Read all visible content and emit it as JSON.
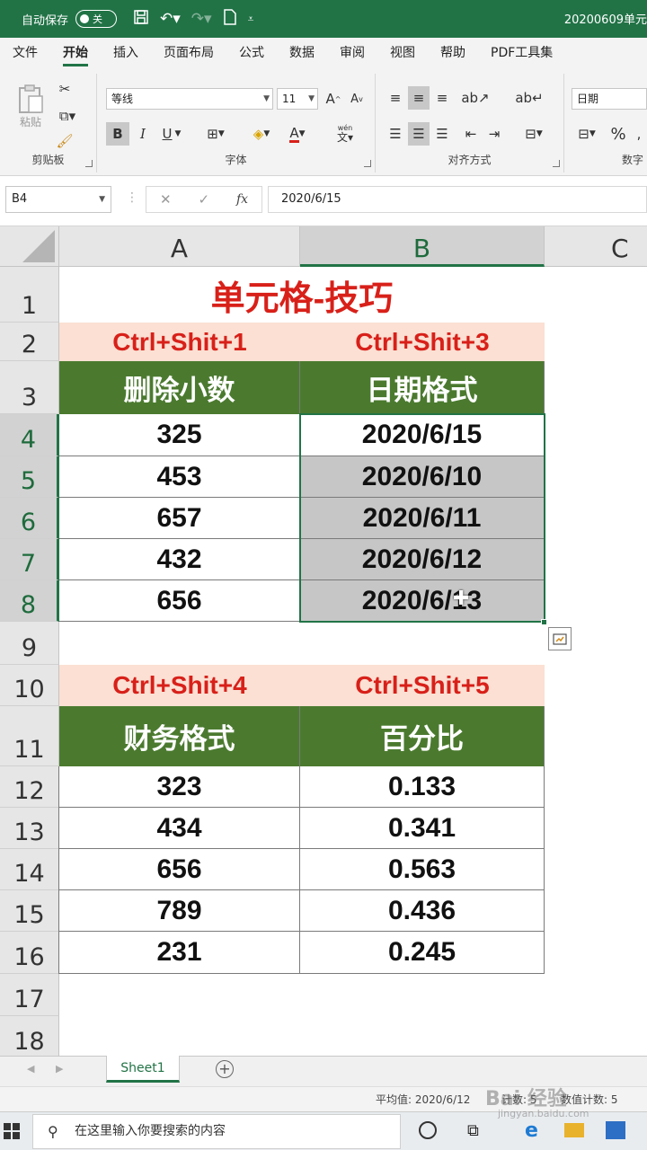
{
  "titlebar": {
    "autosave_label": "自动保存",
    "toggle_state": "关",
    "doc_title": "20200609单元"
  },
  "ribbon_tabs": [
    "文件",
    "开始",
    "插入",
    "页面布局",
    "公式",
    "数据",
    "审阅",
    "视图",
    "帮助",
    "PDF工具集"
  ],
  "active_tab": "开始",
  "ribbon": {
    "clipboard": {
      "paste_label": "粘贴",
      "group_label": "剪贴板"
    },
    "font": {
      "font_name": "等线",
      "font_size": "11",
      "bold": "B",
      "italic": "I",
      "underline": "U",
      "group_label": "字体",
      "phonetic_label": "wén"
    },
    "alignment": {
      "group_label": "对齐方式"
    },
    "number": {
      "format": "日期",
      "percent": "%",
      "group_label": "数字"
    }
  },
  "formula_bar": {
    "name_box": "B4",
    "content": "2020/6/15"
  },
  "columns": [
    "A",
    "B",
    "C"
  ],
  "rows": [
    "1",
    "2",
    "3",
    "4",
    "5",
    "6",
    "7",
    "8",
    "9",
    "10",
    "11",
    "12",
    "13",
    "14",
    "15",
    "16",
    "17",
    "18"
  ],
  "cells": {
    "title": "单元格-技巧",
    "shortcut_a2": "Ctrl+Shit+1",
    "shortcut_b2": "Ctrl+Shit+3",
    "header_a3": "删除小数",
    "header_b3": "日期格式",
    "a_values_1": [
      "325",
      "453",
      "657",
      "432",
      "656"
    ],
    "b_values_1": [
      "2020/6/15",
      "2020/6/10",
      "2020/6/11",
      "2020/6/12",
      "2020/6/13"
    ],
    "shortcut_a10": "Ctrl+Shit+4",
    "shortcut_b10": "Ctrl+Shit+5",
    "header_a11": "财务格式",
    "header_b11": "百分比",
    "a_values_2": [
      "323",
      "434",
      "656",
      "789",
      "231"
    ],
    "b_values_2": [
      "0.133",
      "0.341",
      "0.563",
      "0.436",
      "0.245"
    ]
  },
  "sheet_tab": "Sheet1",
  "status": {
    "average": "平均值: 2020/6/12",
    "count": "计数: 5",
    "numeric_count": "数值计数: 5"
  },
  "taskbar": {
    "search_placeholder": "在这里输入你要搜索的内容"
  },
  "watermark": {
    "text": "Bai 经验",
    "sub": "jingyan.baidu.com"
  },
  "colors": {
    "excel_green": "#217346",
    "header_fill": "#4b7a2f",
    "shortcut_fill": "#fbe0d3",
    "title_red": "#d82019",
    "selection_gray": "#c6c6c6"
  }
}
